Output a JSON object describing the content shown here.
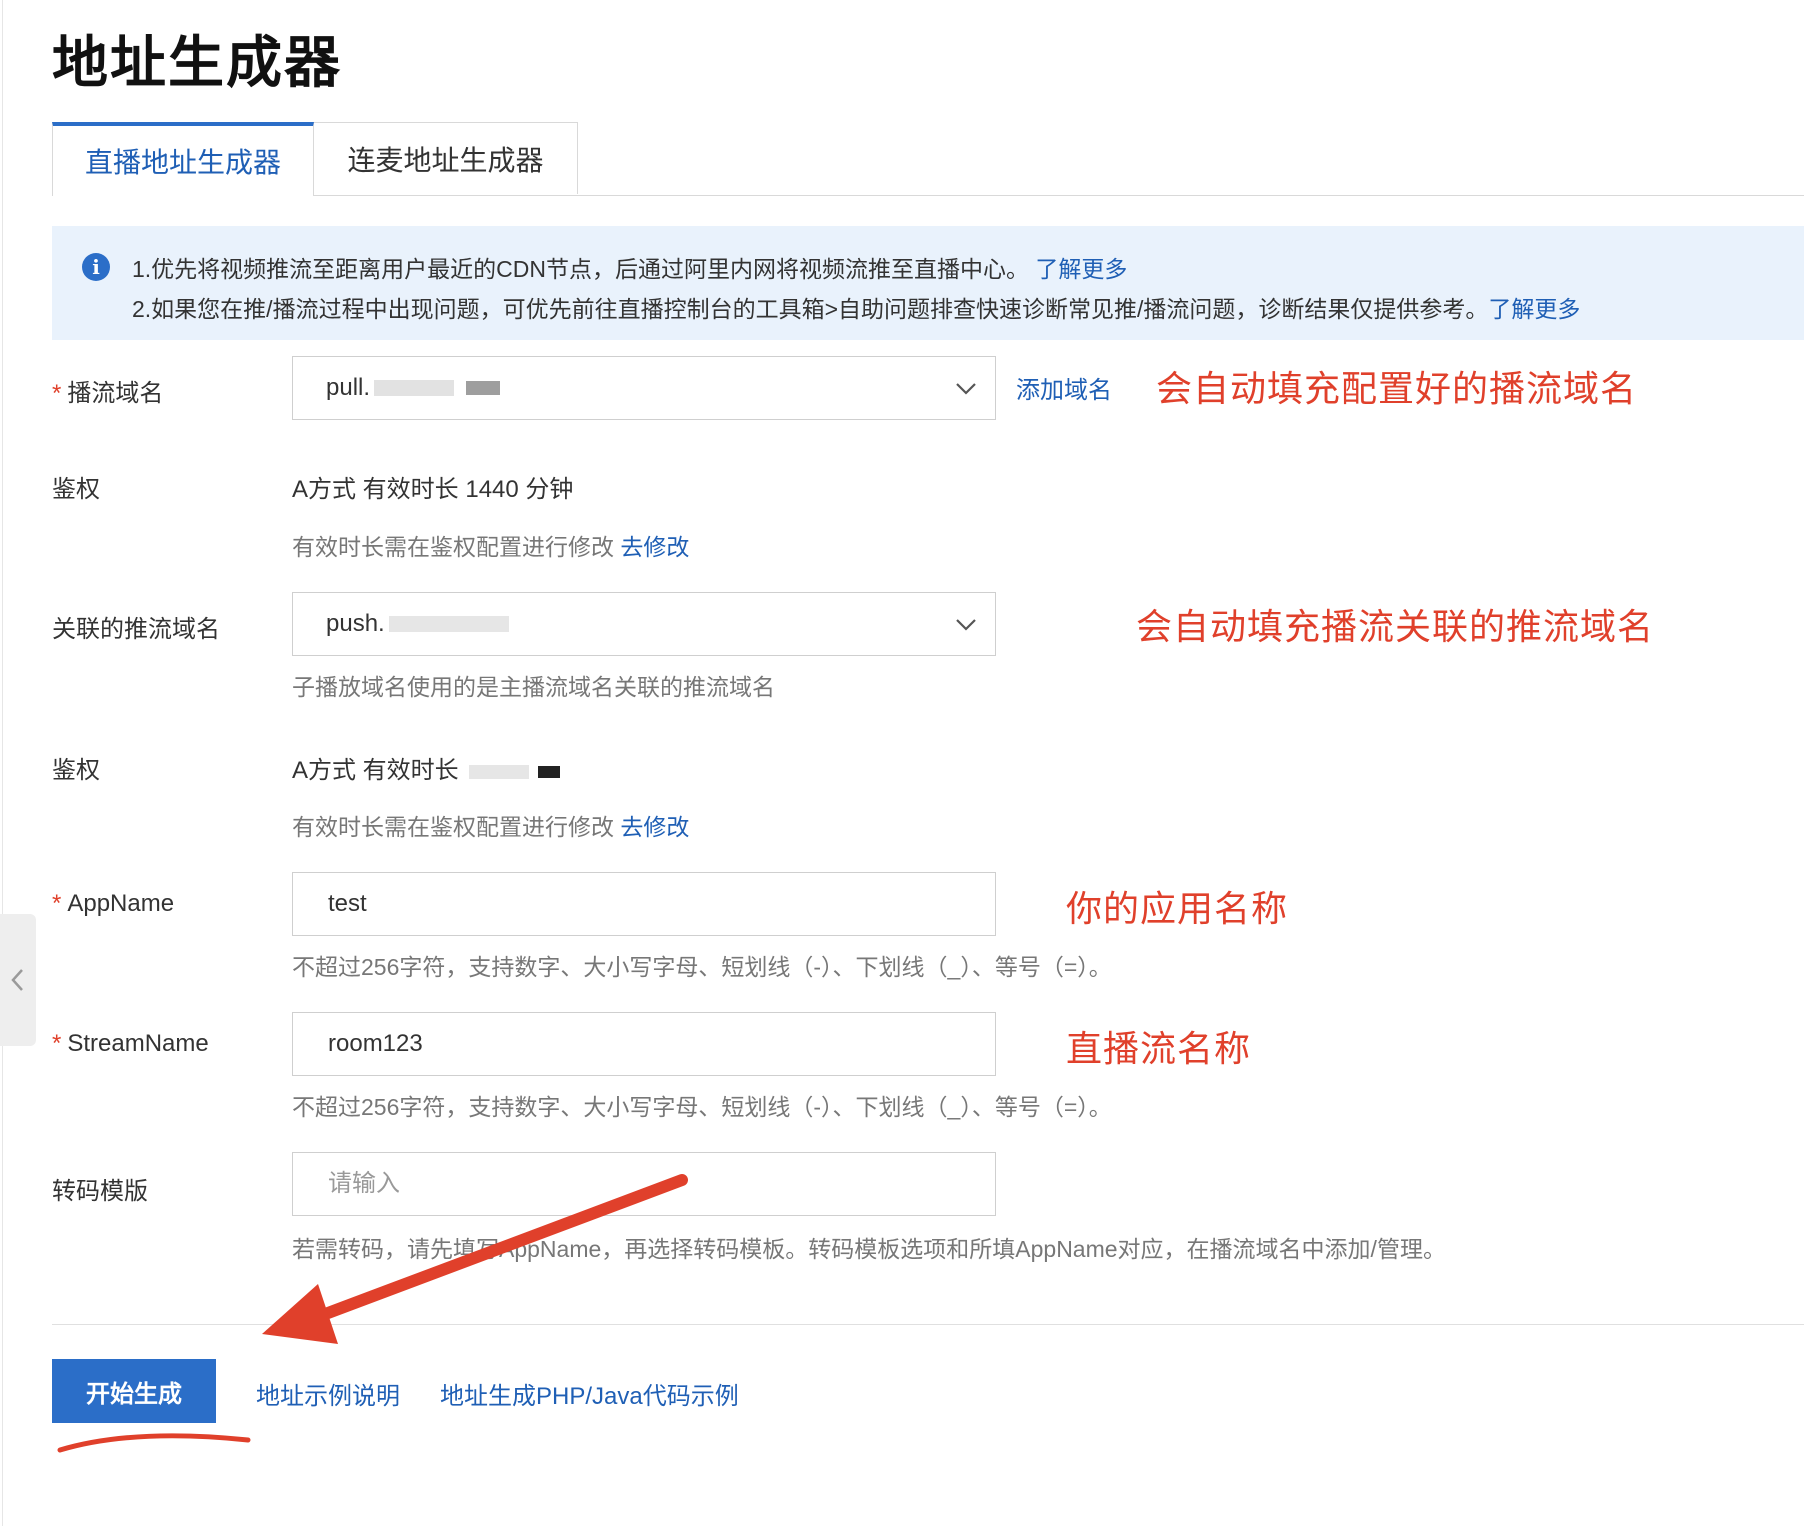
{
  "page": {
    "title": "地址生成器"
  },
  "tabs": [
    {
      "label": "直播地址生成器",
      "active": true
    },
    {
      "label": "连麦地址生成器",
      "active": false
    }
  ],
  "info": {
    "line1": "1.优先将视频推流至距离用户最近的CDN节点，后通过阿里内网将视频流推至直播中心。",
    "line1_link": "了解更多",
    "line2": "2.如果您在推/播流过程中出现问题，可优先前往直播控制台的工具箱>自助问题排查快速诊断常见推/播流问题，诊断结果仅提供参考。",
    "line2_link": "了解更多"
  },
  "form": {
    "pull_domain": {
      "label": "播流域名",
      "required_mark": "*",
      "value": "pull.",
      "add_link": "添加域名"
    },
    "auth1": {
      "label": "鉴权",
      "value": "A方式 有效时长 1440 分钟",
      "hint": "有效时长需在鉴权配置进行修改",
      "hint_link": "去修改"
    },
    "push_domain": {
      "label": "关联的推流域名",
      "value": "push.",
      "hint": "子播放域名使用的是主播流域名关联的推流域名"
    },
    "auth2": {
      "label": "鉴权",
      "value": "A方式 有效时长",
      "hint": "有效时长需在鉴权配置进行修改",
      "hint_link": "去修改"
    },
    "appname": {
      "label": "AppName",
      "required_mark": "*",
      "value": "test",
      "hint": "不超过256字符，支持数字、大小写字母、短划线（-）、下划线（_）、等号（=）。"
    },
    "streamname": {
      "label": "StreamName",
      "required_mark": "*",
      "value": "room123",
      "hint": "不超过256字符，支持数字、大小写字母、短划线（-）、下划线（_）、等号（=）。"
    },
    "transcode": {
      "label": "转码模版",
      "placeholder": "请输入",
      "hint": "若需转码，请先填写AppName，再选择转码模板。转码模板选项和所填AppName对应，在播流域名中添加/管理。"
    }
  },
  "annotations": {
    "pull_domain": "会自动填充配置好的播流域名",
    "push_domain": "会自动填充播流关联的推流域名",
    "appname": "你的应用名称",
    "streamname": "直播流名称"
  },
  "footer": {
    "primary_button": "开始生成",
    "link1": "地址示例说明",
    "link2": "地址生成PHP/Java代码示例"
  },
  "colors": {
    "brand_blue": "#2b6ec8",
    "link_blue": "#1f5fb5",
    "annotation_red": "#e0402b",
    "info_bg": "#e9f2fc"
  }
}
